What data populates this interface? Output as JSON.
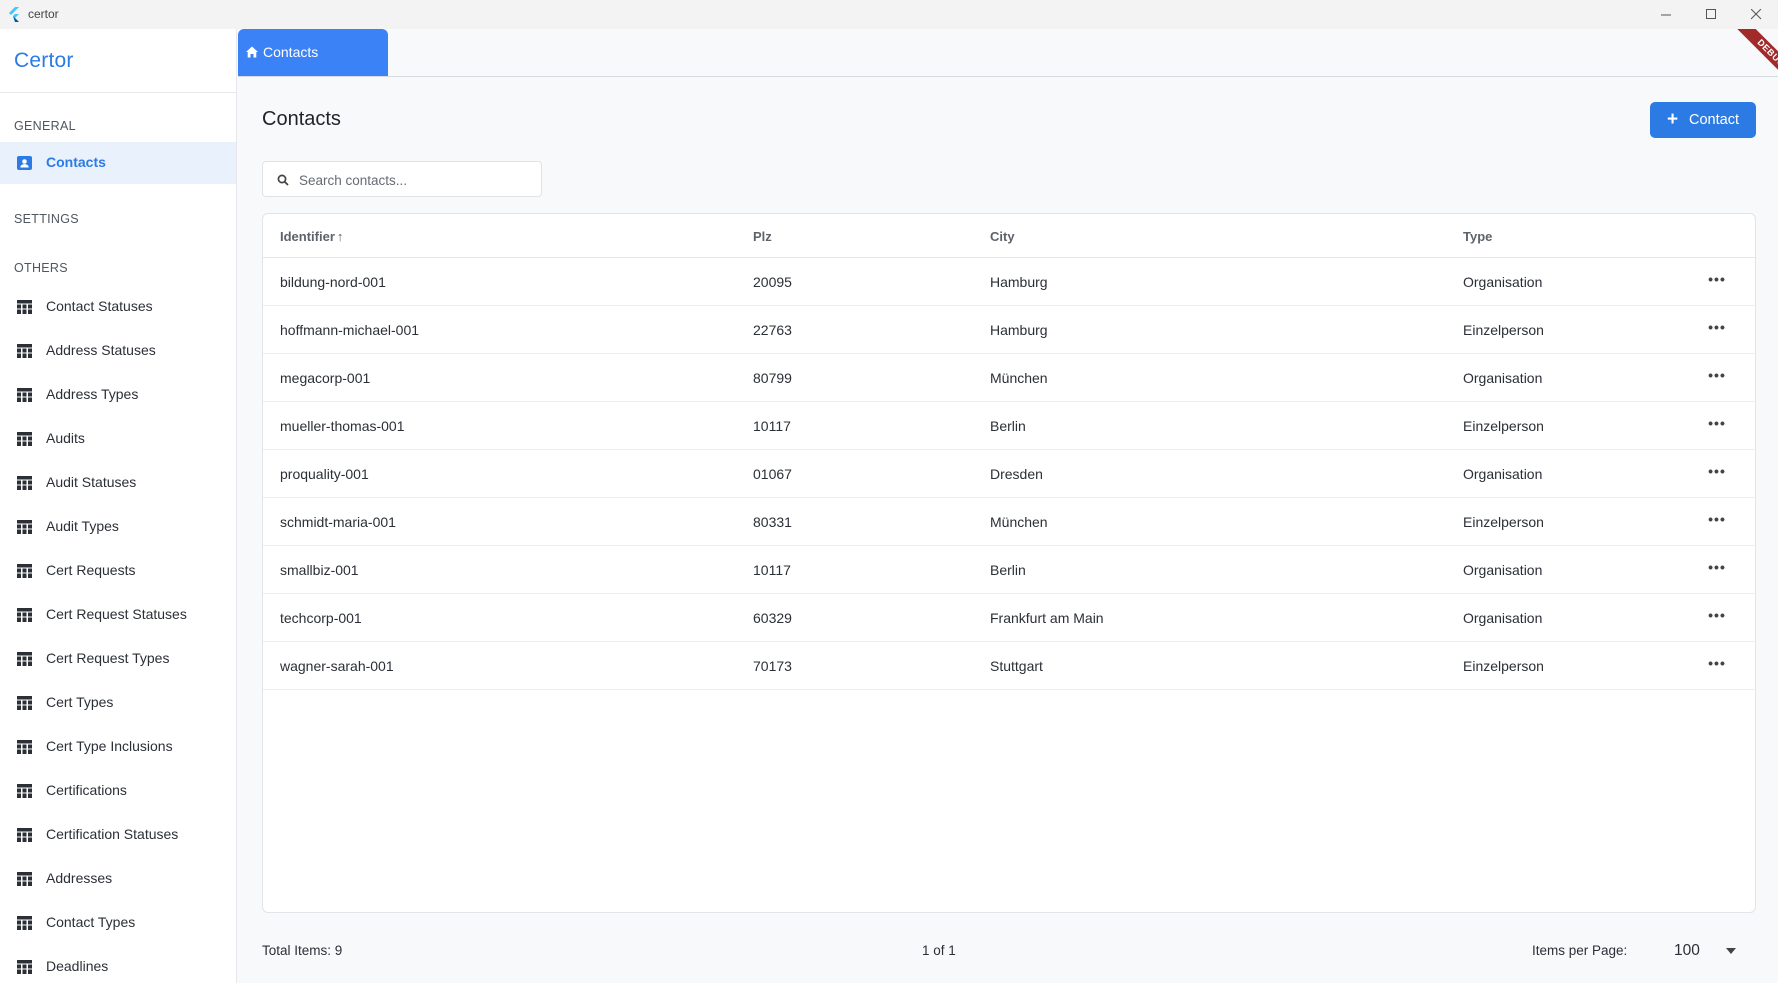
{
  "window": {
    "title": "certor",
    "controls": [
      "minimize-icon",
      "maximize-icon",
      "close-icon"
    ]
  },
  "sidebar": {
    "brand": "Certor",
    "sections": {
      "general": "GENERAL",
      "settings": "SETTINGS",
      "others": "OTHERS"
    },
    "general_items": [
      {
        "label": "Contacts",
        "icon": "contact-card-icon",
        "active": true
      }
    ],
    "other_items": [
      {
        "label": "Contact Statuses",
        "icon": "table-icon"
      },
      {
        "label": "Address Statuses",
        "icon": "table-icon"
      },
      {
        "label": "Address Types",
        "icon": "table-icon"
      },
      {
        "label": "Audits",
        "icon": "table-icon"
      },
      {
        "label": "Audit Statuses",
        "icon": "table-icon"
      },
      {
        "label": "Audit Types",
        "icon": "table-icon"
      },
      {
        "label": "Cert Requests",
        "icon": "table-icon"
      },
      {
        "label": "Cert Request Statuses",
        "icon": "table-icon"
      },
      {
        "label": "Cert Request Types",
        "icon": "table-icon"
      },
      {
        "label": "Cert Types",
        "icon": "table-icon"
      },
      {
        "label": "Cert Type Inclusions",
        "icon": "table-icon"
      },
      {
        "label": "Certifications",
        "icon": "table-icon"
      },
      {
        "label": "Certification Statuses",
        "icon": "table-icon"
      },
      {
        "label": "Addresses",
        "icon": "table-icon"
      },
      {
        "label": "Contact Types",
        "icon": "table-icon"
      },
      {
        "label": "Deadlines",
        "icon": "table-icon"
      }
    ]
  },
  "tabs": [
    {
      "label": "Contacts",
      "icon": "home-icon",
      "active": true
    }
  ],
  "debug_banner": "DEBUG",
  "main": {
    "title": "Contacts",
    "add_button": {
      "label": "Contact",
      "icon": "plus-icon"
    },
    "search": {
      "placeholder": "Search contacts...",
      "value": ""
    }
  },
  "table": {
    "columns": [
      {
        "key": "identifier",
        "label": "Identifier",
        "sorted": "asc"
      },
      {
        "key": "plz",
        "label": "Plz"
      },
      {
        "key": "city",
        "label": "City"
      },
      {
        "key": "type",
        "label": "Type"
      }
    ],
    "rows": [
      {
        "identifier": "bildung-nord-001",
        "plz": "20095",
        "city": "Hamburg",
        "type": "Organisation"
      },
      {
        "identifier": "hoffmann-michael-001",
        "plz": "22763",
        "city": "Hamburg",
        "type": "Einzelperson"
      },
      {
        "identifier": "megacorp-001",
        "plz": "80799",
        "city": "München",
        "type": "Organisation"
      },
      {
        "identifier": "mueller-thomas-001",
        "plz": "10117",
        "city": "Berlin",
        "type": "Einzelperson"
      },
      {
        "identifier": "proquality-001",
        "plz": "01067",
        "city": "Dresden",
        "type": "Organisation"
      },
      {
        "identifier": "schmidt-maria-001",
        "plz": "80331",
        "city": "München",
        "type": "Einzelperson"
      },
      {
        "identifier": "smallbiz-001",
        "plz": "10117",
        "city": "Berlin",
        "type": "Organisation"
      },
      {
        "identifier": "techcorp-001",
        "plz": "60329",
        "city": "Frankfurt am Main",
        "type": "Organisation"
      },
      {
        "identifier": "wagner-sarah-001",
        "plz": "70173",
        "city": "Stuttgart",
        "type": "Einzelperson"
      }
    ],
    "row_action_icon": "more-horizontal-icon"
  },
  "footer": {
    "total_items": "Total Items: 9",
    "page_info": "1 of 1",
    "items_per_page_label": "Items per Page:",
    "items_per_page_value": "100"
  },
  "colors": {
    "accent": "#2c7be5",
    "tab_active": "#3b82f6",
    "sidebar_active_bg": "#e9f1fd",
    "debug_ribbon": "#a12b2b"
  }
}
